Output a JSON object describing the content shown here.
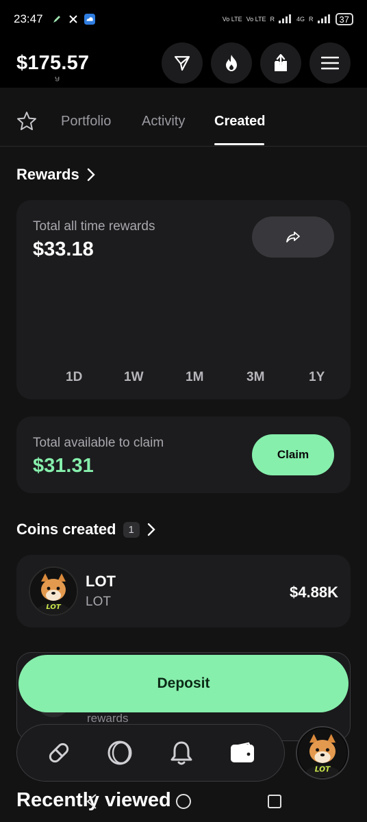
{
  "status_bar": {
    "time": "23:47",
    "network_label_1": "Vo LTE",
    "network_label_2": "Vo LTE",
    "roaming_1": "R",
    "network_type": "4G",
    "roaming_2": "R",
    "battery": "37"
  },
  "header": {
    "balance": "$175.57",
    "partial_subtext": "g"
  },
  "tabs": {
    "items": [
      "Portfolio",
      "Activity",
      "Created"
    ],
    "active": "Created"
  },
  "rewards": {
    "title": "Rewards",
    "total_label": "Total all time rewards",
    "total_value": "$33.18",
    "ranges": [
      "1D",
      "1W",
      "1M",
      "3M",
      "1Y"
    ]
  },
  "claim": {
    "label": "Total available to claim",
    "value": "$31.31",
    "button_label": "Claim"
  },
  "coins_created": {
    "title": "Coins created",
    "count": "1",
    "items": [
      {
        "name": "LOT",
        "ticker": "LOT",
        "value": "$4.88K",
        "logo_text": "LOT"
      }
    ]
  },
  "deposit": {
    "button_label": "Deposit",
    "underlying_text": "rewards"
  },
  "bottom_nav": {
    "items": [
      "link-icon",
      "circle-icon",
      "bell-icon",
      "wallet-icon"
    ],
    "avatar_text": "LOT"
  },
  "recently_viewed": {
    "title": "Recently viewed"
  },
  "colors": {
    "accent_green": "#86efac",
    "background": "#131314",
    "card": "#1c1c1e"
  }
}
